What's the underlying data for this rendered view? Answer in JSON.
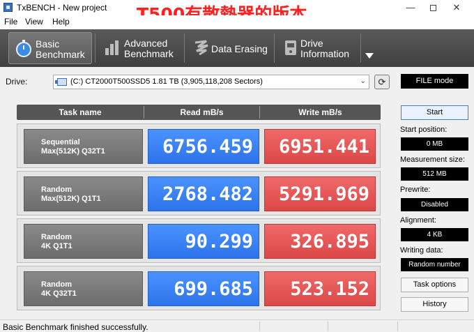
{
  "window": {
    "title": "TxBENCH - New project",
    "overlay_caption": "T500有散熱器的版本",
    "minimize_glyph": "—",
    "close_glyph": "✕"
  },
  "menu": [
    "File",
    "View",
    "Help"
  ],
  "toolbar": {
    "tabs": [
      {
        "label": "Basic\nBenchmark",
        "icon": "stopwatch-icon",
        "active": true
      },
      {
        "label": "Advanced\nBenchmark",
        "icon": "bar-chart-icon",
        "active": false
      },
      {
        "label": "Data Erasing",
        "icon": "eraser-icon",
        "active": false
      },
      {
        "label": "Drive\nInformation",
        "icon": "drive-info-icon",
        "active": false
      }
    ]
  },
  "drive": {
    "label": "Drive:",
    "selected": "(C:) CT2000T500SSD5  1.81 TB (3,905,118,208 Sectors)",
    "refresh_glyph": "⟳"
  },
  "side_panel": {
    "mode": "FILE mode",
    "start_label": "Start",
    "start_position_label": "Start position:",
    "start_position_value": "0 MB",
    "measurement_size_label": "Measurement size:",
    "measurement_size_value": "512 MB",
    "prewrite_label": "Prewrite:",
    "prewrite_value": "Disabled",
    "alignment_label": "Alignment:",
    "alignment_value": "4 KB",
    "writing_data_label": "Writing data:",
    "writing_data_value": "Random number",
    "task_options_label": "Task options",
    "history_label": "History"
  },
  "table": {
    "headers": [
      "Task name",
      "Read mB/s",
      "Write mB/s"
    ],
    "rows": [
      {
        "line1": "Sequential",
        "line2": "Max(512K) Q32T1",
        "read": "6756.459",
        "write": "6951.441"
      },
      {
        "line1": "Random",
        "line2": "Max(512K) Q1T1",
        "read": "2768.482",
        "write": "5291.969"
      },
      {
        "line1": "Random",
        "line2": "4K Q1T1",
        "read": "90.299",
        "write": "326.895"
      },
      {
        "line1": "Random",
        "line2": "4K Q32T1",
        "read": "699.685",
        "write": "523.152"
      }
    ]
  },
  "status": {
    "text": "Basic Benchmark finished successfully."
  }
}
